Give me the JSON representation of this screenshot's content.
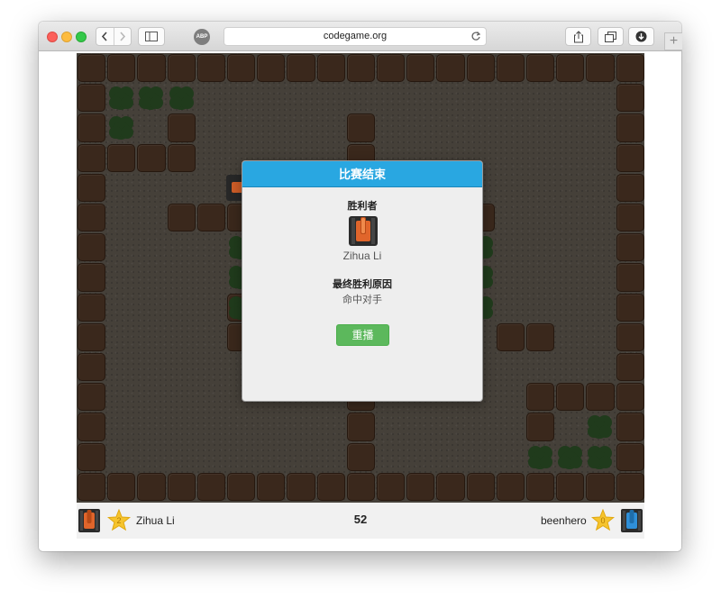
{
  "browser": {
    "url": "codegame.org",
    "abp_label": "ABP"
  },
  "modal": {
    "title": "比赛结束",
    "winner_label": "胜利者",
    "winner_name": "Zihua Li",
    "reason_label": "最终胜利原因",
    "reason_value": "命中对手",
    "replay_button": "重播"
  },
  "players": {
    "left": {
      "name": "Zihua Li",
      "stars": "2",
      "tank_color": "#e0652b"
    },
    "right": {
      "name": "beenhero",
      "stars": "0",
      "tank_color": "#2f8fd8"
    }
  },
  "game": {
    "remaining_turns": "52"
  },
  "colors": {
    "wall": "#3f2c1f",
    "floor": "#4b463e",
    "bush": "#23401f",
    "modal_header": "#29a7e1",
    "replay_button": "#5cb85c",
    "star": "#f6c42d"
  },
  "icons": {
    "traffic_lights": [
      "close",
      "minimize",
      "zoom"
    ],
    "toolbar": [
      "back-icon",
      "forward-icon",
      "sidebar-icon",
      "reload-icon",
      "share-icon",
      "tabs-icon",
      "downloads-icon"
    ]
  }
}
